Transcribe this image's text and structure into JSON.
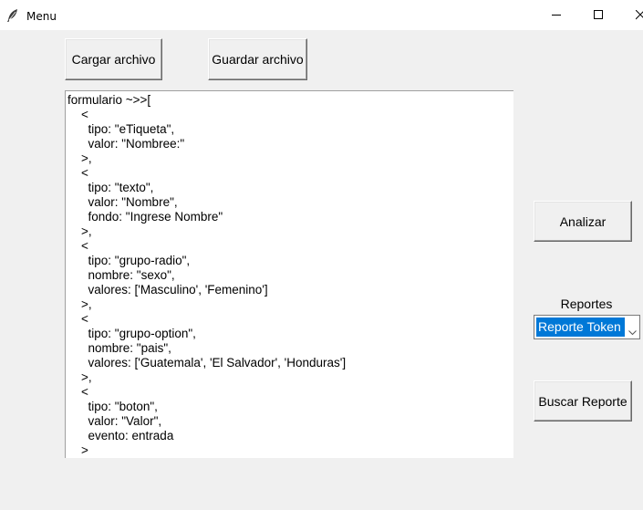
{
  "window": {
    "title": "Menu",
    "icon": "feather-icon"
  },
  "toolbar": {
    "load_label": "Cargar archivo",
    "save_label": "Guardar archivo"
  },
  "editor": {
    "content": "formulario ~>>[\n    <\n      tipo: \"eTiqueta\",\n      valor: \"Nombree:\"\n    >,\n    <\n      tipo: \"texto\",\n      valor: \"Nombre\",\n      fondo: \"Ingrese Nombre\"\n    >,\n    <\n      tipo: \"grupo-radio\",\n      nombre: \"sexo\",\n      valores: ['Masculino', 'Femenino']\n    >,\n    <\n      tipo: \"grupo-option\",\n      nombre: \"pais\",\n      valores: ['Guatemala', 'El Salvador', 'Honduras']\n    >,\n    <\n      tipo: \"boton\",\n      valor: \"Valor\",\n      evento: entrada\n    >"
  },
  "side": {
    "analyze_label": "Analizar",
    "reports_label": "Reportes",
    "reports_select": {
      "value": "Reporte Token"
    },
    "search_label": "Buscar Reporte"
  },
  "colors": {
    "selection": "#0078d7",
    "background": "#f0f0f0"
  }
}
